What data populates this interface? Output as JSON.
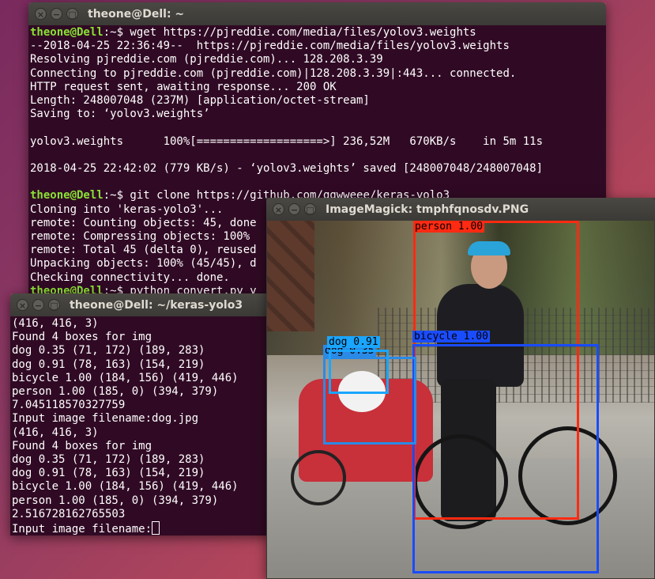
{
  "terminal1": {
    "title": "theone@Dell: ~",
    "lines": [
      {
        "p": "theone@Dell",
        "c": ":~$ wget https://pjreddie.com/media/files/yolov3.weights"
      },
      {
        "t": "--2018-04-25 22:36:49--  https://pjreddie.com/media/files/yolov3.weights"
      },
      {
        "t": "Resolving pjreddie.com (pjreddie.com)... 128.208.3.39"
      },
      {
        "t": "Connecting to pjreddie.com (pjreddie.com)|128.208.3.39|:443... connected."
      },
      {
        "t": "HTTP request sent, awaiting response... 200 OK"
      },
      {
        "t": "Length: 248007048 (237M) [application/octet-stream]"
      },
      {
        "t": "Saving to: ‘yolov3.weights’"
      },
      {
        "t": ""
      },
      {
        "t": "yolov3.weights      100%[===================>] 236,52M   670KB/s    in 5m 11s"
      },
      {
        "t": ""
      },
      {
        "t": "2018-04-25 22:42:02 (779 KB/s) - ‘yolov3.weights’ saved [248007048/248007048]"
      },
      {
        "t": ""
      },
      {
        "p": "theone@Dell",
        "c": ":~$ git clone https://github.com/qqwweee/keras-yolo3"
      },
      {
        "t": "Cloning into 'keras-yolo3'..."
      },
      {
        "t": "remote: Counting objects: 45, done"
      },
      {
        "t": "remote: Compressing objects: 100%"
      },
      {
        "t": "remote: Total 45 (delta 0), reused"
      },
      {
        "t": "Unpacking objects: 100% (45/45), d"
      },
      {
        "t": "Checking connectivity... done."
      },
      {
        "p": "theone@Dell",
        "c": ":~$ python convert.py y"
      }
    ]
  },
  "terminal2": {
    "title": "theone@Dell: ~/keras-yolo3",
    "lines": [
      "(416, 416, 3)",
      "Found 4 boxes for img",
      "dog 0.35 (71, 172) (189, 283)",
      "dog 0.91 (78, 163) (154, 219)",
      "bicycle 1.00 (184, 156) (419, 446)",
      "person 1.00 (185, 0) (394, 379)",
      "7.045118570327759",
      "Input image filename:dog.jpg",
      "(416, 416, 3)",
      "Found 4 boxes for img",
      "dog 0.35 (71, 172) (189, 283)",
      "dog 0.91 (78, 163) (154, 219)",
      "bicycle 1.00 (184, 156) (419, 446)",
      "person 1.00 (185, 0) (394, 379)",
      "2.516728162765503"
    ],
    "input_prompt": "Input image filename:"
  },
  "imagemagick": {
    "title": "ImageMagick: tmphfqnosdv.PNG",
    "labels": {
      "person": "person 1.00",
      "bicycle": "bicycle 1.00",
      "dog_high": "dog 0.91",
      "dog_low": "dog 0.35"
    }
  },
  "window_buttons": {
    "close": "×",
    "minimize": "−",
    "maximize": "□"
  },
  "colors": {
    "terminal_bg": "#300a24",
    "prompt_green": "#8ae234",
    "person_box": "#ff2a12",
    "bicycle_box": "#1a4cff",
    "dog_box_high": "#1aa6ff",
    "dog_box_low": "#2a8ae6"
  }
}
